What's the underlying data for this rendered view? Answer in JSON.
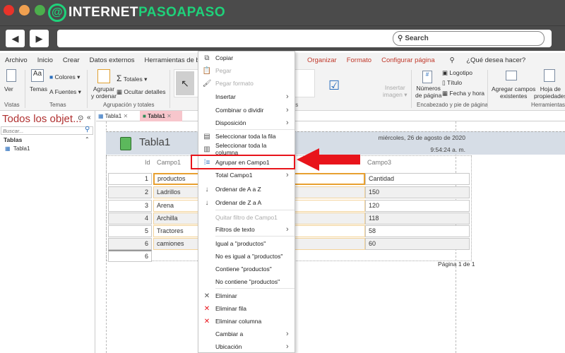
{
  "browser": {
    "logo_text_1": "INTERNET",
    "logo_text_2": "PASOAPASO",
    "search_label": "Search",
    "back": "◀",
    "forward": "▶"
  },
  "ribbon_tabs": [
    "Archivo",
    "Inicio",
    "Crear",
    "Datos externos",
    "Herramientas de ba",
    "Organizar",
    "Formato",
    "Configurar página",
    "¿Qué desea hacer?"
  ],
  "ribbon": {
    "ver": "Ver",
    "vistas": "Vistas",
    "temas": "Temas",
    "colores": "Colores",
    "fuentes": "Fuentes",
    "temas_group": "Temas",
    "agrupar": "Agrupar",
    "y_ordenar": "y ordenar",
    "totales": "Totales",
    "ocultar": "Ocultar detalles",
    "agrupacion_group": "Agrupación y totales",
    "controles_group_tail": "les",
    "insertar": "Insertar",
    "imagen": "imagen",
    "numeros": "Números",
    "de_pagina": "de página",
    "logotipo": "Logotipo",
    "titulo": "Título",
    "fecha_hora": "Fecha y hora",
    "encabezado_group": "Encabezado y pie de página",
    "agregar_campos": "Agregar campos",
    "existentes": "existentes",
    "hoja": "Hoja de",
    "propiedades": "propiedades",
    "herramientas_group": "Herramientas"
  },
  "nav": {
    "title": "Todos los objet...",
    "search_placeholder": "Buscar...",
    "section": "Tablas",
    "items": [
      "Tabla1"
    ]
  },
  "doc_tabs": [
    {
      "label": "Tabla1",
      "active": false
    },
    {
      "label": "Tabla1",
      "active": true
    }
  ],
  "report": {
    "title": "Tabla1",
    "date": "miércoles, 26 de agosto de 2020",
    "time": "9:54:24 a. m.",
    "headers": {
      "id": "Id",
      "campo1": "Campo1",
      "campo3": "Campo3"
    },
    "rows": [
      {
        "id": "1",
        "campo1": "productos",
        "campo3": "Cantidad"
      },
      {
        "id": "2",
        "campo1": "Ladrillos",
        "campo3": "150"
      },
      {
        "id": "3",
        "campo1": "Arena",
        "campo3": "120"
      },
      {
        "id": "4",
        "campo1": "Archilla",
        "campo3": "118"
      },
      {
        "id": "5",
        "campo1": "Tractores",
        "campo3": "58"
      },
      {
        "id": "6",
        "campo1": "camiones",
        "campo3": "60"
      }
    ],
    "count": "6",
    "page": "Página 1 de 1"
  },
  "context_menu": [
    {
      "label": "Copiar",
      "icon": "copy-icon",
      "glyph": "⧉"
    },
    {
      "label": "Pegar",
      "icon": "paste-icon",
      "glyph": "📋",
      "disabled": true
    },
    {
      "label": "Pegar formato",
      "icon": "paste-format-icon",
      "glyph": "🖌",
      "disabled": true
    },
    {
      "label": "Insertar",
      "submenu": true
    },
    {
      "label": "Combinar o dividir",
      "submenu": true
    },
    {
      "label": "Disposición",
      "submenu": true
    },
    {
      "label": "Seleccionar toda la fila",
      "icon": "select-row-icon",
      "glyph": "▤"
    },
    {
      "label": "Seleccionar toda la columna",
      "icon": "select-column-icon",
      "glyph": "▥"
    },
    {
      "label": "Agrupar en Campo1",
      "icon": "group-icon",
      "glyph": "⁞≡",
      "highlighted": true
    },
    {
      "label": "Total Campo1",
      "submenu": true
    },
    {
      "label": "Ordenar de A a Z",
      "icon": "sort-az-icon",
      "glyph": "↓"
    },
    {
      "label": "Ordenar de Z a A",
      "icon": "sort-za-icon",
      "glyph": "↓"
    },
    {
      "label": "Quitar filtro de Campo1",
      "disabled": true
    },
    {
      "label": "Filtros de texto",
      "submenu": true
    },
    {
      "label": "Igual a \"productos\""
    },
    {
      "label": "No es igual a \"productos\""
    },
    {
      "label": "Contiene \"productos\""
    },
    {
      "label": "No contiene \"productos\""
    },
    {
      "label": "Eliminar",
      "icon": "delete-icon",
      "glyph": "✕"
    },
    {
      "label": "Eliminar fila",
      "icon": "delete-row-icon",
      "glyph": "✕"
    },
    {
      "label": "Eliminar columna",
      "icon": "delete-column-icon",
      "glyph": "✕"
    },
    {
      "label": "Cambiar a",
      "submenu": true
    },
    {
      "label": "Ubicación",
      "submenu": true
    }
  ],
  "colors": {
    "highlight": "#e8141b",
    "accent_red": "#c0392b",
    "logo_green": "#1fd17a",
    "header_band": "#d6dde6"
  }
}
